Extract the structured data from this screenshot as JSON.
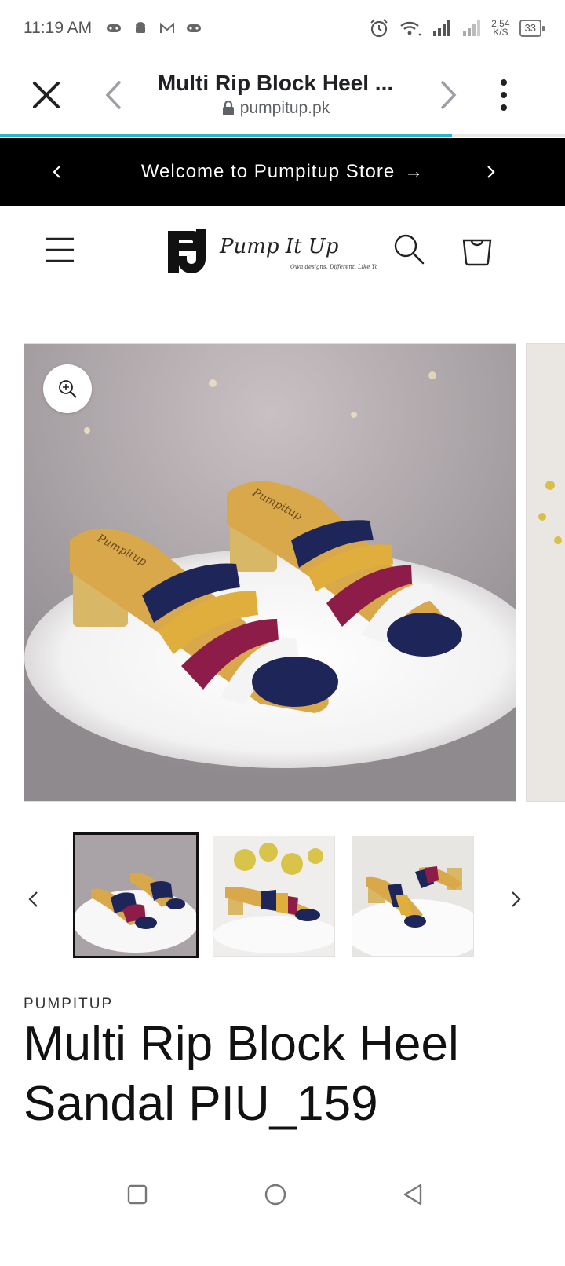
{
  "status_bar": {
    "time": "11:19 AM",
    "net_speed_value": "2.54",
    "net_speed_unit": "K/S",
    "battery": "33"
  },
  "browser": {
    "page_title": "Multi Rip Block Heel ...",
    "url": "pumpitup.pk",
    "load_progress": 0.8
  },
  "announcement": {
    "text": "Welcome to Pumpitup Store",
    "arrow": "→"
  },
  "header": {
    "brand_monogram": "PU",
    "brand_script": "Pump It Up",
    "brand_tagline": "Own designs, Different, Like You"
  },
  "product": {
    "vendor": "PUMPITUP",
    "title": "Multi Rip Block Heel Sandal PIU_159",
    "insole_brand": "Pumpitup",
    "thumbnails_count": 3,
    "active_thumbnail": 1
  },
  "colors": {
    "accent_progress": "#2bb5c8",
    "announcement_bg": "#000000",
    "strap_navy": "#1d2559",
    "strap_mustard": "#e0ae3c",
    "strap_maroon": "#8e1c48",
    "strap_white": "#f4f4f4",
    "heel_tan": "#d8b766"
  },
  "icons": {
    "close": "close-icon",
    "back": "chevron-left-icon",
    "forward": "chevron-right-icon",
    "menu": "more-vert-icon",
    "lock": "lock-icon",
    "hamburger": "hamburger-icon",
    "search": "search-icon",
    "cart": "cart-icon",
    "zoom": "zoom-in-icon"
  }
}
